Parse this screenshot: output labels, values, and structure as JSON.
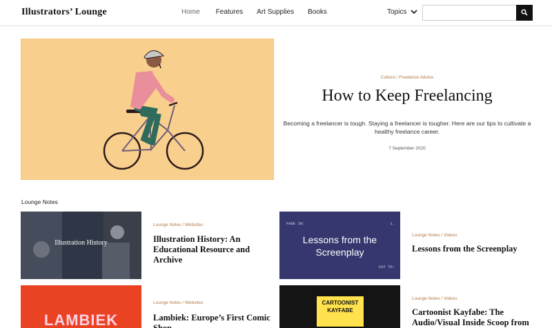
{
  "header": {
    "logo": "Illustrators’ Lounge",
    "nav": [
      {
        "label": "Home",
        "active": true
      },
      {
        "label": "Features",
        "active": false
      },
      {
        "label": "Art Supplies",
        "active": false
      },
      {
        "label": "Books",
        "active": false
      }
    ],
    "topics_label": "Topics",
    "search_placeholder": ""
  },
  "hero": {
    "category": "Culture / Freelance Advice",
    "title": "How to Keep Freelancing",
    "description": "Becoming a freelancer is tough. Staying a freelancer is tougher. Here are our tips to cultivate a healthy freelance career.",
    "date": "7 September 2020"
  },
  "section": {
    "label": "Lounge Notes"
  },
  "cards": [
    {
      "category": "Lounge Notes / Websites",
      "title": "Illustration History: An Educational Resource and Archive",
      "thumb_text": "Illustration History"
    },
    {
      "category": "Lounge Notes / Videos",
      "title": "Lessons from the Screenplay",
      "thumb_text": "Lessons from the Screenplay",
      "thumb_corner_tl": "FADE IN:",
      "thumb_corner_tr": "1.",
      "thumb_corner_br": "CUT TO:"
    },
    {
      "category": "Lounge Notes / Websites",
      "title": "Lambiek: Europe’s First Comic Shop",
      "thumb_text": "LAMBIEK"
    },
    {
      "category": "Lounge Notes / Videos",
      "title": "Cartoonist Kayfabe: The Audio/Visual Inside Scoop from",
      "thumb_text": "CARTOONIST KAYFABE"
    }
  ],
  "colors": {
    "accent_meta": "#b07a48",
    "hero_bg": "#f9cf8e",
    "screenplay_bg": "#35376e",
    "lambiek_bg": "#ea4323"
  },
  "icons": {
    "topics": "chevron-down-icon",
    "search": "search-icon"
  }
}
